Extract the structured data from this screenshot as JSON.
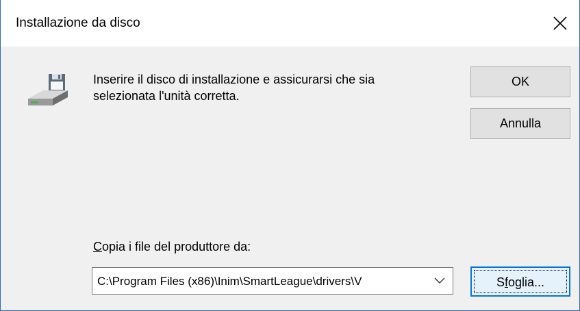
{
  "window": {
    "title": "Installazione da disco"
  },
  "message": {
    "line1": "Inserire il disco di installazione e assicurarsi che sia",
    "line2": "selezionata l'unità corretta."
  },
  "buttons": {
    "ok": "OK",
    "cancel": "Annulla",
    "browse_pre": "S",
    "browse_accel": "f",
    "browse_post": "oglia..."
  },
  "copy_from": {
    "label_accel": "C",
    "label_rest": "opia i file del produttore da:",
    "value": "C:\\Program Files (x86)\\Inim\\SmartLeague\\drivers\\V"
  },
  "icons": {
    "drive": "floppy-drive-icon",
    "close": "close-icon",
    "dropdown": "chevron-down-icon"
  },
  "colors": {
    "title_bar": "#ffffff",
    "dialog_bg": "#f0f0f0",
    "button_bg": "#e1e1e1",
    "focus_border": "#0078d7"
  }
}
